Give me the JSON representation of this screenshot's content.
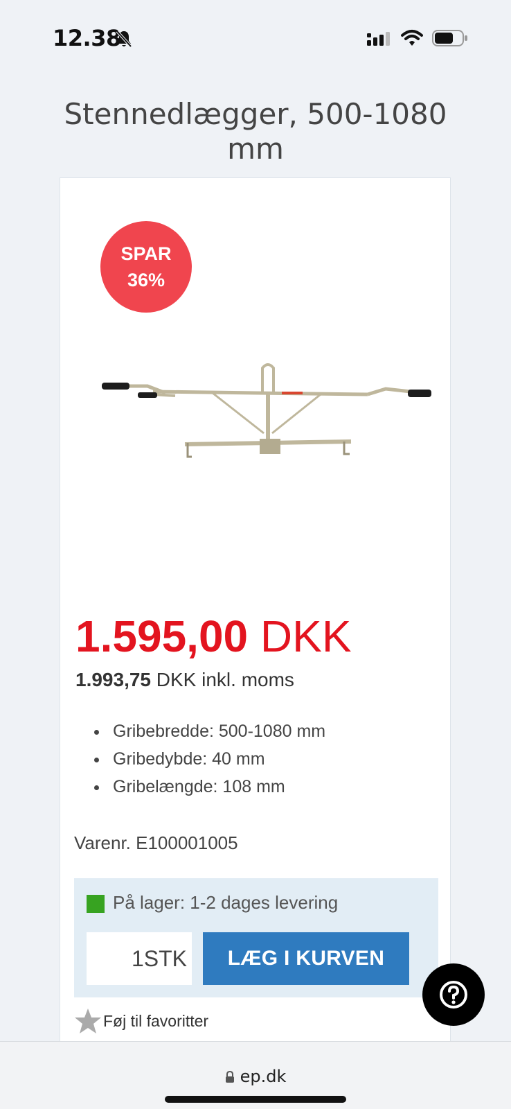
{
  "status_bar": {
    "time": "12.38"
  },
  "product": {
    "title": "Stennedlægger, 500-1080 mm",
    "badge": {
      "line1": "SPAR",
      "line2": "36%",
      "color": "#f0454e"
    },
    "price": {
      "amount": "1.595,00",
      "currency": "DKK",
      "color": "#e3141f"
    },
    "price_incl": {
      "amount": "1.993,75",
      "suffix": "DKK inkl. moms"
    },
    "specs": [
      "Gribebredde: 500-1080 mm",
      "Gribedybde: 40 mm",
      "Gribelængde: 108 mm"
    ],
    "sku": "Varenr. E100001005"
  },
  "stock": {
    "text": "På lager: 1-2 dages levering",
    "indicator_color": "#37a321"
  },
  "cart": {
    "quantity_value": "1STK",
    "add_label": "LÆG I KURVEN",
    "button_color": "#2f7bbf"
  },
  "favorite": {
    "label": "Føj til favoritter",
    "icon": "star-icon"
  },
  "help": {
    "icon": "question-circle-icon"
  },
  "browser": {
    "url": "ep.dk",
    "icon": "lock-icon"
  }
}
